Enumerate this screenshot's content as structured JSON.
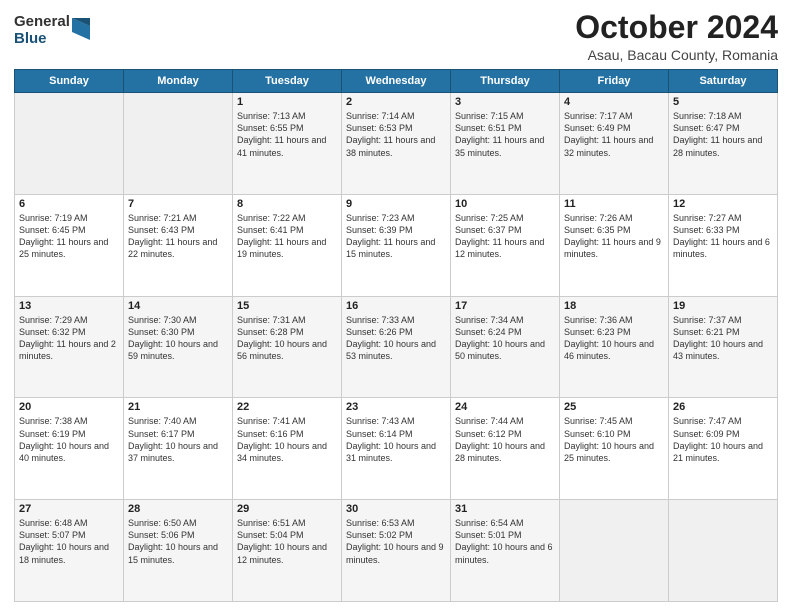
{
  "logo": {
    "general": "General",
    "blue": "Blue"
  },
  "header": {
    "month": "October 2024",
    "location": "Asau, Bacau County, Romania"
  },
  "weekdays": [
    "Sunday",
    "Monday",
    "Tuesday",
    "Wednesday",
    "Thursday",
    "Friday",
    "Saturday"
  ],
  "weeks": [
    [
      {
        "day": "",
        "sunrise": "",
        "sunset": "",
        "daylight": ""
      },
      {
        "day": "",
        "sunrise": "",
        "sunset": "",
        "daylight": ""
      },
      {
        "day": "1",
        "sunrise": "Sunrise: 7:13 AM",
        "sunset": "Sunset: 6:55 PM",
        "daylight": "Daylight: 11 hours and 41 minutes."
      },
      {
        "day": "2",
        "sunrise": "Sunrise: 7:14 AM",
        "sunset": "Sunset: 6:53 PM",
        "daylight": "Daylight: 11 hours and 38 minutes."
      },
      {
        "day": "3",
        "sunrise": "Sunrise: 7:15 AM",
        "sunset": "Sunset: 6:51 PM",
        "daylight": "Daylight: 11 hours and 35 minutes."
      },
      {
        "day": "4",
        "sunrise": "Sunrise: 7:17 AM",
        "sunset": "Sunset: 6:49 PM",
        "daylight": "Daylight: 11 hours and 32 minutes."
      },
      {
        "day": "5",
        "sunrise": "Sunrise: 7:18 AM",
        "sunset": "Sunset: 6:47 PM",
        "daylight": "Daylight: 11 hours and 28 minutes."
      }
    ],
    [
      {
        "day": "6",
        "sunrise": "Sunrise: 7:19 AM",
        "sunset": "Sunset: 6:45 PM",
        "daylight": "Daylight: 11 hours and 25 minutes."
      },
      {
        "day": "7",
        "sunrise": "Sunrise: 7:21 AM",
        "sunset": "Sunset: 6:43 PM",
        "daylight": "Daylight: 11 hours and 22 minutes."
      },
      {
        "day": "8",
        "sunrise": "Sunrise: 7:22 AM",
        "sunset": "Sunset: 6:41 PM",
        "daylight": "Daylight: 11 hours and 19 minutes."
      },
      {
        "day": "9",
        "sunrise": "Sunrise: 7:23 AM",
        "sunset": "Sunset: 6:39 PM",
        "daylight": "Daylight: 11 hours and 15 minutes."
      },
      {
        "day": "10",
        "sunrise": "Sunrise: 7:25 AM",
        "sunset": "Sunset: 6:37 PM",
        "daylight": "Daylight: 11 hours and 12 minutes."
      },
      {
        "day": "11",
        "sunrise": "Sunrise: 7:26 AM",
        "sunset": "Sunset: 6:35 PM",
        "daylight": "Daylight: 11 hours and 9 minutes."
      },
      {
        "day": "12",
        "sunrise": "Sunrise: 7:27 AM",
        "sunset": "Sunset: 6:33 PM",
        "daylight": "Daylight: 11 hours and 6 minutes."
      }
    ],
    [
      {
        "day": "13",
        "sunrise": "Sunrise: 7:29 AM",
        "sunset": "Sunset: 6:32 PM",
        "daylight": "Daylight: 11 hours and 2 minutes."
      },
      {
        "day": "14",
        "sunrise": "Sunrise: 7:30 AM",
        "sunset": "Sunset: 6:30 PM",
        "daylight": "Daylight: 10 hours and 59 minutes."
      },
      {
        "day": "15",
        "sunrise": "Sunrise: 7:31 AM",
        "sunset": "Sunset: 6:28 PM",
        "daylight": "Daylight: 10 hours and 56 minutes."
      },
      {
        "day": "16",
        "sunrise": "Sunrise: 7:33 AM",
        "sunset": "Sunset: 6:26 PM",
        "daylight": "Daylight: 10 hours and 53 minutes."
      },
      {
        "day": "17",
        "sunrise": "Sunrise: 7:34 AM",
        "sunset": "Sunset: 6:24 PM",
        "daylight": "Daylight: 10 hours and 50 minutes."
      },
      {
        "day": "18",
        "sunrise": "Sunrise: 7:36 AM",
        "sunset": "Sunset: 6:23 PM",
        "daylight": "Daylight: 10 hours and 46 minutes."
      },
      {
        "day": "19",
        "sunrise": "Sunrise: 7:37 AM",
        "sunset": "Sunset: 6:21 PM",
        "daylight": "Daylight: 10 hours and 43 minutes."
      }
    ],
    [
      {
        "day": "20",
        "sunrise": "Sunrise: 7:38 AM",
        "sunset": "Sunset: 6:19 PM",
        "daylight": "Daylight: 10 hours and 40 minutes."
      },
      {
        "day": "21",
        "sunrise": "Sunrise: 7:40 AM",
        "sunset": "Sunset: 6:17 PM",
        "daylight": "Daylight: 10 hours and 37 minutes."
      },
      {
        "day": "22",
        "sunrise": "Sunrise: 7:41 AM",
        "sunset": "Sunset: 6:16 PM",
        "daylight": "Daylight: 10 hours and 34 minutes."
      },
      {
        "day": "23",
        "sunrise": "Sunrise: 7:43 AM",
        "sunset": "Sunset: 6:14 PM",
        "daylight": "Daylight: 10 hours and 31 minutes."
      },
      {
        "day": "24",
        "sunrise": "Sunrise: 7:44 AM",
        "sunset": "Sunset: 6:12 PM",
        "daylight": "Daylight: 10 hours and 28 minutes."
      },
      {
        "day": "25",
        "sunrise": "Sunrise: 7:45 AM",
        "sunset": "Sunset: 6:10 PM",
        "daylight": "Daylight: 10 hours and 25 minutes."
      },
      {
        "day": "26",
        "sunrise": "Sunrise: 7:47 AM",
        "sunset": "Sunset: 6:09 PM",
        "daylight": "Daylight: 10 hours and 21 minutes."
      }
    ],
    [
      {
        "day": "27",
        "sunrise": "Sunrise: 6:48 AM",
        "sunset": "Sunset: 5:07 PM",
        "daylight": "Daylight: 10 hours and 18 minutes."
      },
      {
        "day": "28",
        "sunrise": "Sunrise: 6:50 AM",
        "sunset": "Sunset: 5:06 PM",
        "daylight": "Daylight: 10 hours and 15 minutes."
      },
      {
        "day": "29",
        "sunrise": "Sunrise: 6:51 AM",
        "sunset": "Sunset: 5:04 PM",
        "daylight": "Daylight: 10 hours and 12 minutes."
      },
      {
        "day": "30",
        "sunrise": "Sunrise: 6:53 AM",
        "sunset": "Sunset: 5:02 PM",
        "daylight": "Daylight: 10 hours and 9 minutes."
      },
      {
        "day": "31",
        "sunrise": "Sunrise: 6:54 AM",
        "sunset": "Sunset: 5:01 PM",
        "daylight": "Daylight: 10 hours and 6 minutes."
      },
      {
        "day": "",
        "sunrise": "",
        "sunset": "",
        "daylight": ""
      },
      {
        "day": "",
        "sunrise": "",
        "sunset": "",
        "daylight": ""
      }
    ]
  ]
}
